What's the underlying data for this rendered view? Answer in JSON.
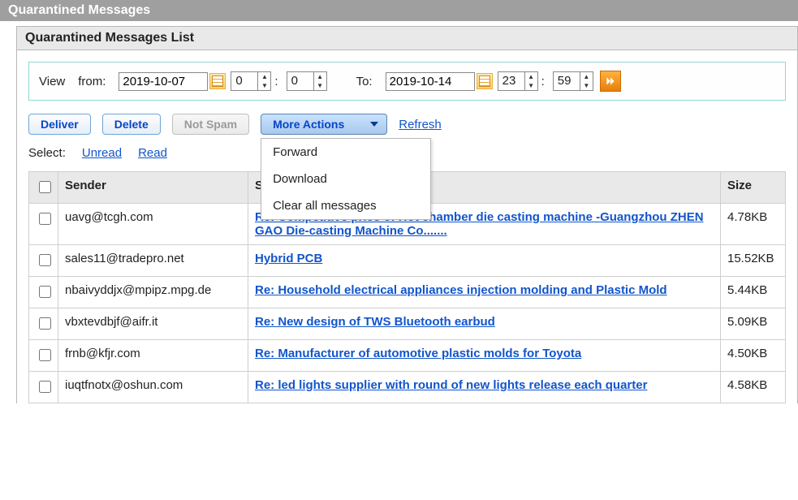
{
  "header": {
    "title": "Quarantined Messages"
  },
  "panel": {
    "title": "Quarantined Messages List"
  },
  "dateBar": {
    "viewLabel": "View",
    "fromLabel": "from:",
    "toLabel": "To:",
    "fromDate": "2019-10-07",
    "fromHour": "0",
    "fromMin": "0",
    "toDate": "2019-10-14",
    "toHour": "23",
    "toMin": "59"
  },
  "actions": {
    "deliver": "Deliver",
    "delete": "Delete",
    "notSpam": "Not Spam",
    "more": "More Actions",
    "refresh": "Refresh"
  },
  "moreMenu": {
    "forward": "Forward",
    "download": "Download",
    "clearAll": "Clear all messages"
  },
  "selectRow": {
    "label": "Select:",
    "unread": "Unread",
    "read": "Read"
  },
  "table": {
    "headers": {
      "sender": "Sender",
      "subject": "Subject",
      "size": "Size"
    },
    "rows": [
      {
        "sender": "uavg@tcgh.com",
        "subject": "Re: Competitive price of Hot chamber die casting machine -Guangzhou ZHEN GAO Die-casting Machine Co.......",
        "size": "4.78KB"
      },
      {
        "sender": "sales11@tradepro.net",
        "subject": "Hybrid PCB",
        "size": "15.52KB"
      },
      {
        "sender": "nbaivyddjx@mpipz.mpg.de",
        "subject": "Re: Household electrical appliances injection molding and Plastic Mold",
        "size": "5.44KB"
      },
      {
        "sender": "vbxtevdbjf@aifr.it",
        "subject": "Re: New design of TWS Bluetooth earbud",
        "size": "5.09KB"
      },
      {
        "sender": "frnb@kfjr.com",
        "subject": "Re: Manufacturer of automotive plastic molds for Toyota",
        "size": "4.50KB"
      },
      {
        "sender": "iuqtfnotx@oshun.com",
        "subject": "Re: led lights supplier with round of new lights release each quarter",
        "size": "4.58KB"
      }
    ]
  }
}
